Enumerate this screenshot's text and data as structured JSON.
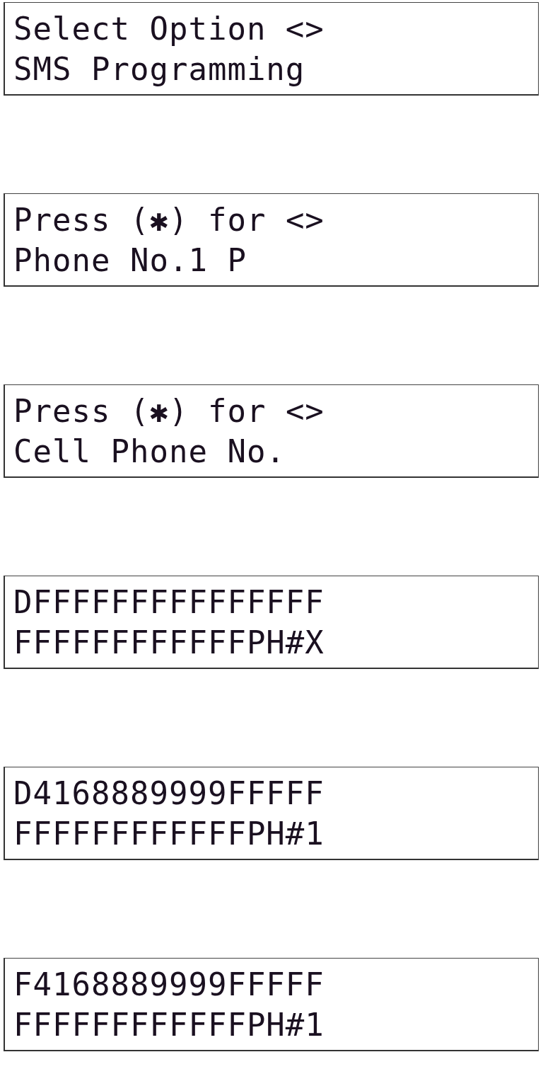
{
  "displays": [
    {
      "lines": [
        "Select Option <>",
        "SMS Programming"
      ]
    },
    {
      "lines": [
        "Press (**✱**) for <>",
        "Phone No.1 P"
      ]
    },
    {
      "lines": [
        "Press (**✱**) for <>",
        "Cell Phone No."
      ]
    },
    {
      "lines": [
        "DFFFFFFFFFFFFFFF",
        "FFFFFFFFFFFFPH#X"
      ]
    },
    {
      "lines": [
        "D4168889999FFFFF",
        "FFFFFFFFFFFFPH#1"
      ]
    },
    {
      "lines": [
        "F4168889999FFFFF",
        "FFFFFFFFFFFFPH#1"
      ]
    }
  ]
}
